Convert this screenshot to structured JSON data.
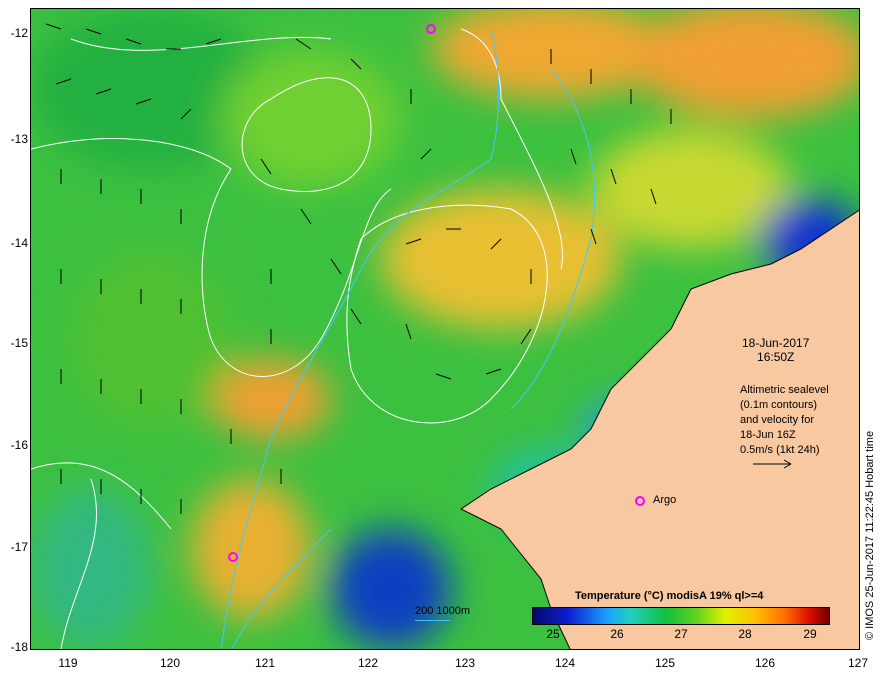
{
  "map": {
    "date": "18-Jun-2017",
    "time": "16:50Z",
    "legend_text": [
      "Altimetric sealevel",
      "(0.1m contours)",
      "and velocity for",
      "18-Jun 16Z",
      "0.5m/s (1kt 24h)"
    ],
    "side_label": "© IMOS 25-Jun-2017 11:22:45 Hobart time",
    "argo_label": "Argo",
    "depth_scale": "200  1000m",
    "colorbar": {
      "title": "Temperature (°C) modisA 19% ql>=4",
      "ticks": [
        "25",
        "26",
        "27",
        "28",
        "29"
      ]
    },
    "y_ticks": [
      "-12",
      "-13",
      "-14",
      "-15",
      "-16",
      "-17",
      "-18"
    ],
    "x_ticks": [
      "119",
      "120",
      "121",
      "122",
      "123",
      "124",
      "125",
      "126",
      "127"
    ],
    "colors": {
      "land": "#f8c8a0",
      "ocean_warm": "#f0a020",
      "ocean_mid": "#40c040",
      "ocean_cool": "#1030d0",
      "contours": "#ffffff",
      "isobath": "#40c8ff",
      "argo": "#ff00ff"
    }
  }
}
